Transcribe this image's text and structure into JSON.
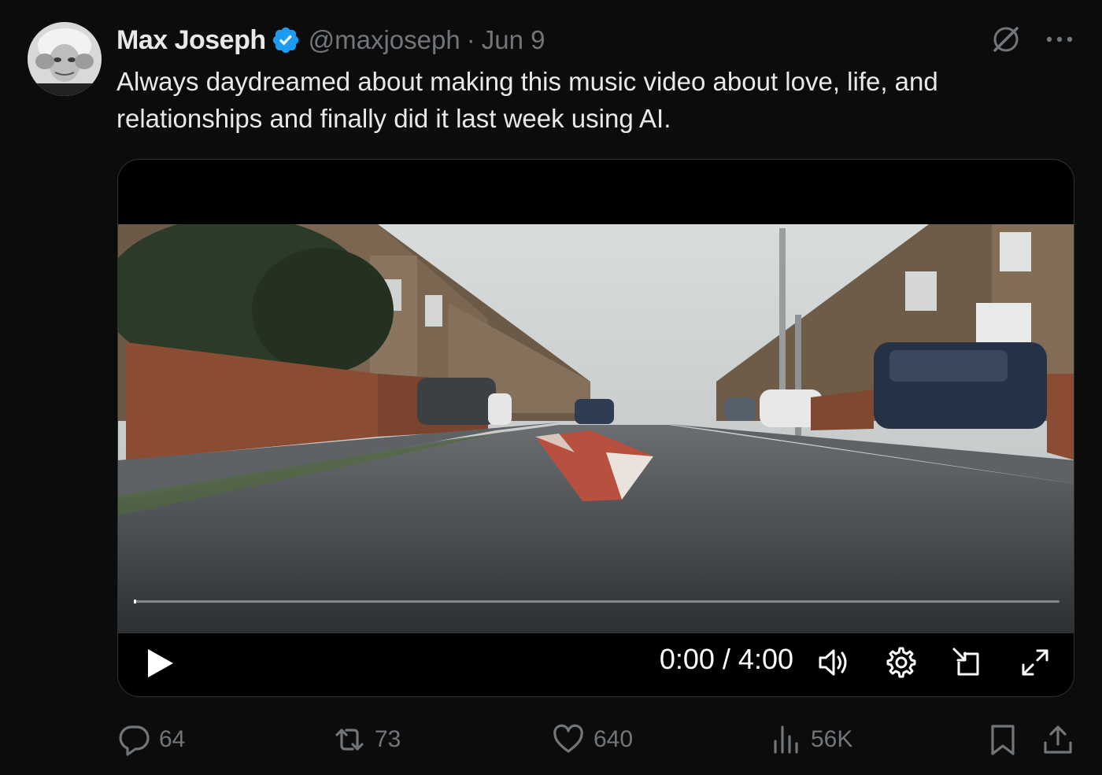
{
  "author": {
    "display_name": "Max Joseph",
    "handle": "@maxjoseph",
    "separator": "·",
    "date": "Jun 9"
  },
  "tweet": {
    "text_line1": "Always daydreamed about making this music video about love, life, and",
    "text_line2": "relationships and finally did it last week using AI."
  },
  "video": {
    "current_time": "0:00",
    "time_separator": " / ",
    "duration": "4:00",
    "time_display": "0:00 / 4:00",
    "progress": 0.0
  },
  "actions": {
    "replies": "64",
    "reposts": "73",
    "likes": "640",
    "views": "56K"
  },
  "icons": {
    "verified": "verified-badge-icon",
    "grok": "grok-icon",
    "more": "more-icon",
    "play": "play-icon",
    "volume": "volume-icon",
    "settings": "gear-icon",
    "pip": "picture-in-picture-icon",
    "fullscreen": "fullscreen-icon",
    "reply": "reply-icon",
    "repost": "repost-icon",
    "like": "heart-icon",
    "views": "views-icon",
    "bookmark": "bookmark-icon",
    "share": "share-icon"
  },
  "colors": {
    "background": "#0c0c0d",
    "primary_text": "#e7e9ea",
    "secondary_text": "#71767b",
    "verified_blue": "#1d9bf0"
  }
}
